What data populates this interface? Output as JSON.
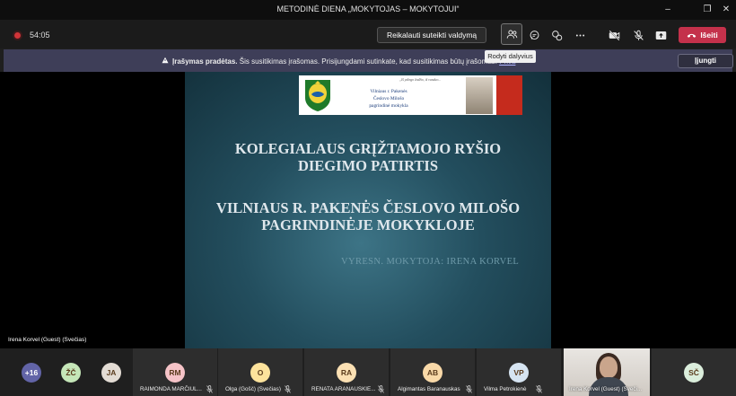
{
  "window": {
    "title": "METODINĖ DIENA „MOKYTOJAS – MOKYTOJUI“",
    "minimize": "–",
    "maximize": "❐",
    "close": "✕"
  },
  "toolbar": {
    "timer": "54:05",
    "request_control_label": "Reikalauti suteikti valdymą",
    "tooltip": "Rodyti dalyvius",
    "leave_label": "Išeiti"
  },
  "banner": {
    "bold_text": "Įrašymas pradėtas.",
    "text": "Šis susitikimas įrašomas. Prisijungdami sutinkate, kad susitikimas būtų įrašomas.",
    "link_text": "Priva",
    "join_label": "Įjungti"
  },
  "stage": {
    "presenter_label": "Irena Korvel (Guest) (Svečias)"
  },
  "slide": {
    "school_name_lines": [
      "Vilniaus r. Pakenės",
      "Česlovo Milošo",
      "pagrindinė mokykla"
    ],
    "quote": "„Iš ydingo žodžio, iš vanduo...",
    "title1_lines": [
      "KOLEGIALAUS GRĮŽTAMOJO RYŠIO",
      "DIEGIMO PATIRTIS"
    ],
    "title2_lines": [
      "VILNIAUS R. PAKENĖS ČESLOVO MILOŠO",
      "PAGRINDINĖJE MOKYKLOJE"
    ],
    "author": "VYRESN. MOKYTOJA: IRENA KORVEL"
  },
  "participants": {
    "overflow": "+16",
    "small": [
      {
        "initials": "ŽČ",
        "color": "#c5e6b8"
      },
      {
        "initials": "JA",
        "color": "#e3dcd4"
      }
    ],
    "tiles": [
      {
        "initials": "RM",
        "name": "RAIMONDA MARČIUL...",
        "color": "#f5c3c7"
      },
      {
        "initials": "O",
        "name": "Olga (Gošč) (Svečias)",
        "color": "#fde39c"
      },
      {
        "initials": "RA",
        "name": "RENATA ARANAUSKIE...",
        "color": "#fbe0b3"
      },
      {
        "initials": "AB",
        "name": "Algimantas Baranauskas",
        "color": "#f9d9a8"
      },
      {
        "initials": "VP",
        "name": "Vilma Petrokienė",
        "color": "#d6e4f1"
      }
    ],
    "video": {
      "name": "Irena Korvel (Guest) (Sveči..."
    },
    "last": {
      "initials": "SČ",
      "color": "#dbeedc"
    },
    "avatar_text_color": "#5a3b1c"
  }
}
